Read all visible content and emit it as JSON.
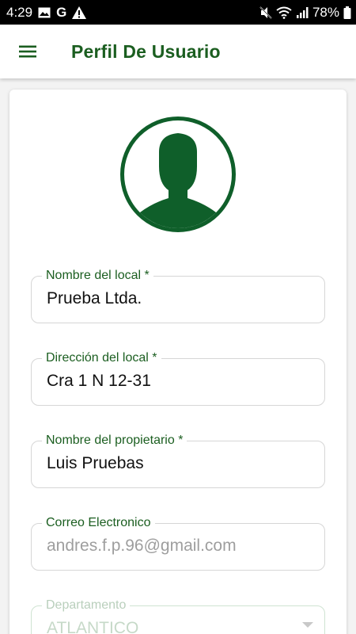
{
  "status_bar": {
    "time": "4:29",
    "left_icons": [
      "image-icon",
      "google-g-icon",
      "warning-icon"
    ],
    "google_letter": "G",
    "right_icons": [
      "mute-icon",
      "wifi-icon",
      "signal-icon",
      "battery-icon"
    ],
    "battery": "78%"
  },
  "app_bar": {
    "title": "Perfil De Usuario",
    "menu_icon": "hamburger-menu-icon"
  },
  "colors": {
    "primary": "#1b5e20",
    "avatar": "#0f5f2a",
    "field_border": "#d6d6d6",
    "status_bar": "#000000"
  },
  "form": {
    "nombre_local": {
      "label": "Nombre del local *",
      "value": "Prueba Ltda."
    },
    "direccion_local": {
      "label": "Dirección del local *",
      "value": "Cra 1 N 12-31"
    },
    "nombre_propietario": {
      "label": "Nombre del propietario *",
      "value": "Luis Pruebas"
    },
    "correo": {
      "label": "Correo Electronico",
      "value": "andres.f.p.96@gmail.com"
    },
    "departamento": {
      "label": "Departamento",
      "value": "ATLANTICO"
    }
  }
}
